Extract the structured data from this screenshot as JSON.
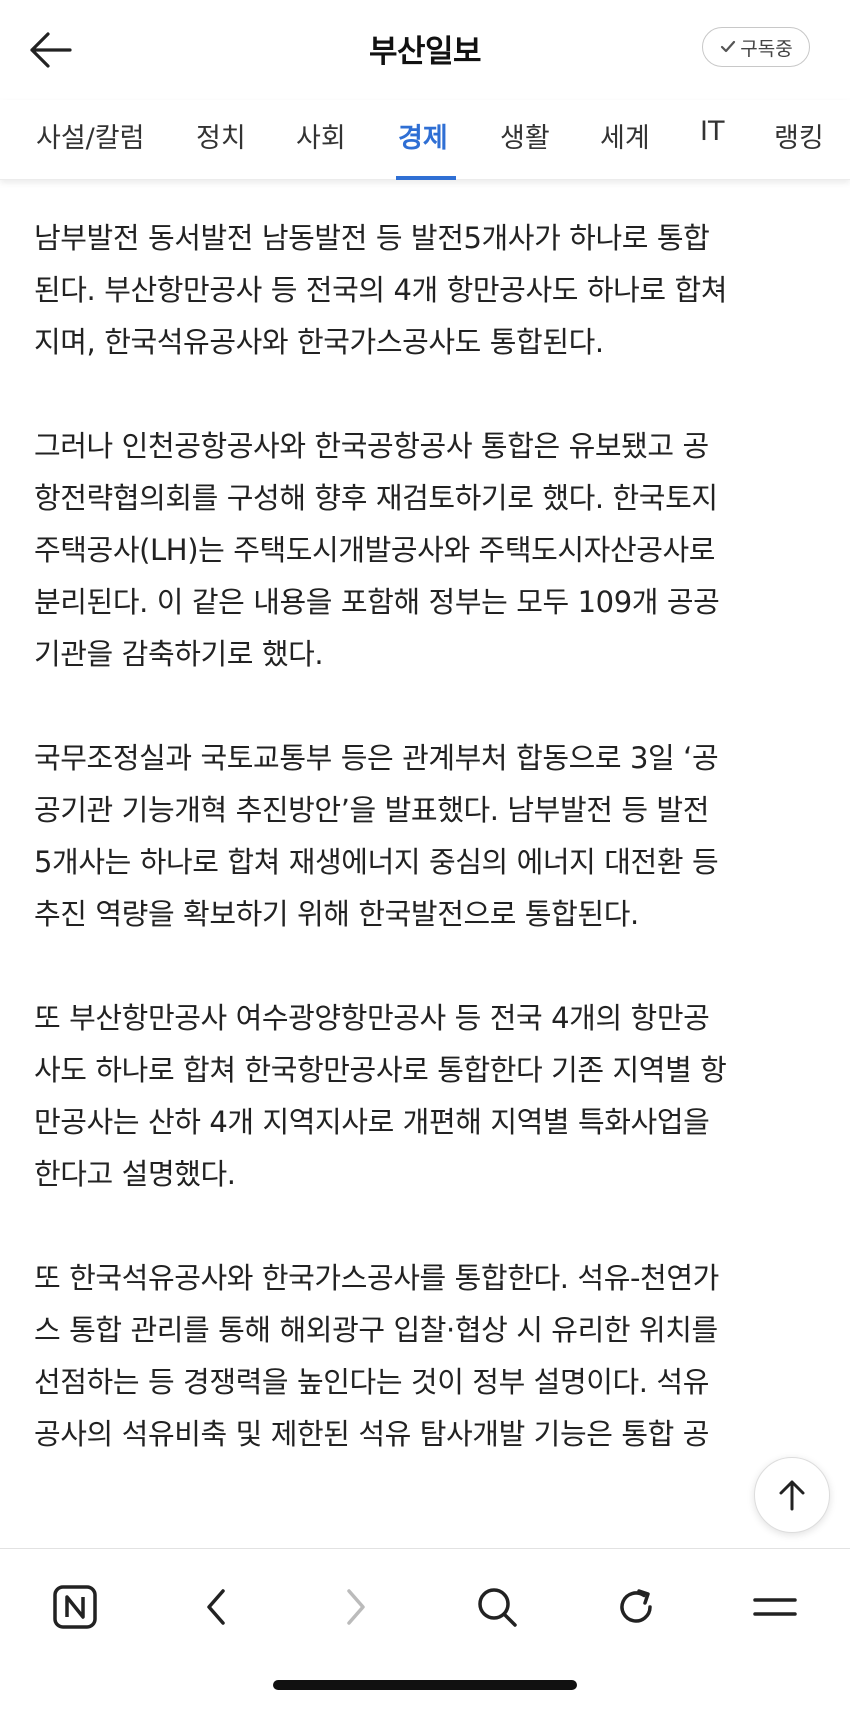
{
  "header": {
    "title": "부산일보",
    "subscribe_label": "구독중",
    "back_icon": "back-arrow-icon"
  },
  "tabs": [
    {
      "label": "사설/칼럼",
      "active": false
    },
    {
      "label": "정치",
      "active": false
    },
    {
      "label": "사회",
      "active": false
    },
    {
      "label": "경제",
      "active": true
    },
    {
      "label": "생활",
      "active": false
    },
    {
      "label": "세계",
      "active": false
    },
    {
      "label": "IT",
      "active": false
    },
    {
      "label": "랭킹",
      "active": false
    }
  ],
  "article": {
    "paragraphs": [
      {
        "lines": [
          "남부발전 동서발전 남동발전 등 발전5개사가 하나로 통합",
          "된다. 부산항만공사 등 전국의 4개 항만공사도 하나로 합쳐",
          "지며, 한국석유공사와 한국가스공사도 통합된다."
        ]
      },
      {
        "lines": [
          "그러나 인천공항공사와 한국공항공사 통합은 유보됐고 공",
          "항전략협의회를 구성해 향후 재검토하기로 했다. 한국토지",
          "주택공사(LH)는 주택도시개발공사와 주택도시자산공사로",
          "분리된다. 이 같은 내용을 포함해 정부는 모두 109개 공공",
          "기관을 감축하기로 했다."
        ]
      },
      {
        "lines": [
          "국무조정실과 국토교통부 등은 관계부처 합동으로 3일 ‘공",
          "공기관 기능개혁 추진방안’을 발표했다. 남부발전 등 발전",
          "5개사는 하나로 합쳐 재생에너지 중심의 에너지 대전환 등",
          "추진 역량을 확보하기 위해 한국발전으로 통합된다."
        ]
      },
      {
        "lines": [
          "또 부산항만공사 여수광양항만공사 등 전국 4개의 항만공",
          "사도 하나로 합쳐 한국항만공사로 통합한다 기존 지역별 항",
          "만공사는 산하 4개 지역지사로 개편해 지역별 특화사업을",
          "한다고 설명했다."
        ]
      },
      {
        "lines": [
          "또 한국석유공사와 한국가스공사를 통합한다. 석유-천연가",
          "스 통합 관리를 통해 해외광구 입찰·협상 시 유리한 위치를",
          "선점하는 등 경쟁력을 높인다는 것이 정부 설명이다. 석유",
          "공사의 석유비축 및 제한된 석유 탐사개발 기능은 통합 공"
        ]
      }
    ]
  },
  "floating": {
    "scroll_top_icon": "arrow-up-icon"
  },
  "toolbar": {
    "items": [
      "n-logo-icon",
      "back-icon",
      "forward-icon",
      "search-icon",
      "refresh-icon",
      "menu-icon"
    ],
    "forward_disabled": true
  },
  "colors": {
    "accent": "#2f6fd4",
    "text": "#222222",
    "muted": "#bbbbbb"
  }
}
